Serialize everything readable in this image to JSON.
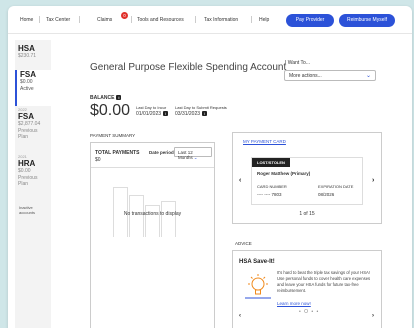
{
  "nav": {
    "items": [
      "Home",
      "Tax Center",
      "Claims",
      "Tools and Resources",
      "Tax Information",
      "Help"
    ],
    "claims_badge": "0",
    "pay_provider": "Pay Provider",
    "reimburse": "Reimburse Myself"
  },
  "sidebar": {
    "accounts": [
      {
        "title": "HSA",
        "lines": [
          "$230.71"
        ],
        "year": ""
      },
      {
        "title": "FSA",
        "lines": [
          "$0.00",
          "Active"
        ],
        "year": ""
      },
      {
        "title": "FSA",
        "lines": [
          "$2,877.04",
          "Previous",
          "Plan"
        ],
        "year": "2022"
      },
      {
        "title": "HRA",
        "lines": [
          "$0.00",
          "Previous",
          "Plan"
        ],
        "year": "2021"
      }
    ],
    "account_year_top": "2022",
    "inactive_label": [
      "Inactive",
      "accounts"
    ]
  },
  "main": {
    "title": "General Purpose Flexible Spending Account",
    "balance_label": "BALANCE",
    "balance_amount": "$0.00",
    "last_day_incur_label": "Last Day to Incur",
    "last_day_incur": "01/01/2023",
    "last_day_submit_label": "Last Day to Submit Requests",
    "last_day_submit": "03/31/2023"
  },
  "iwant": {
    "label": "I Want To...",
    "selected": "More actions..."
  },
  "payment_summary": {
    "title": "PAYMENT SUMMARY",
    "total_label": "TOTAL PAYMENTS",
    "total_value": "$0",
    "date_period_label": "Date period:",
    "date_period_value": "Last 12 Months",
    "empty_text": "No transactions to display"
  },
  "payment_card": {
    "link": "MY PAYMENT CARD",
    "status": "LOST/STOLEN",
    "name": "Roger Matthew (Primary)",
    "card_number_label": "CARD NUMBER",
    "card_number": "---- ---- 7803",
    "expiration_label": "EXPIRATION DATE",
    "expiration": "08/2026",
    "pager": "1 of 15"
  },
  "advice": {
    "title": "ADVICE",
    "heading": "HSA Save-It!",
    "text": "It's hard to beat the triple tax savings of your HSA! Use personal funds to cover health care expenses and leave your HSA funds for future tax-free reimbursement.",
    "link": "Learn more now!",
    "dots": "• O • •"
  },
  "colors": {
    "accent": "#2c52d8",
    "badge": "#e0312b",
    "background": "#cfe6e8"
  }
}
